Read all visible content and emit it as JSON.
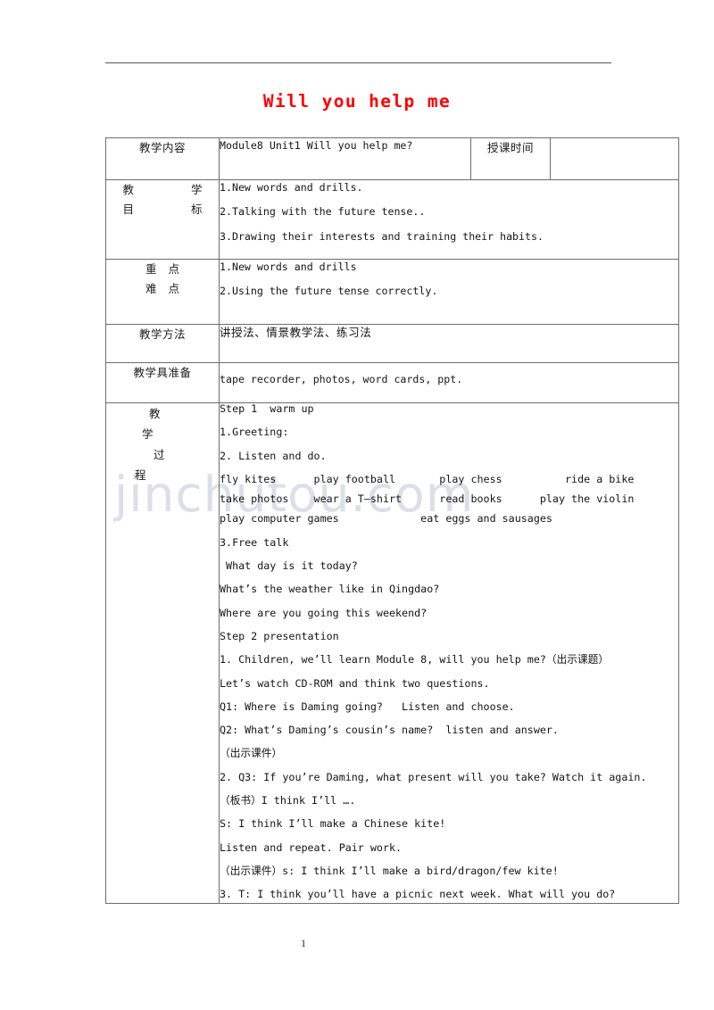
{
  "document": {
    "title": "Will you help me",
    "title_color": "#ff0000",
    "page_number": "1",
    "watermark": "jinchutou.com"
  },
  "table": {
    "rows": {
      "content": {
        "label": "教学内容",
        "value": "Module8 Unit1 Will you help me?",
        "time_label": "授课时间",
        "time_value": ""
      },
      "objectives": {
        "label_line1": "教　　学",
        "label_line2": "目　　标",
        "label_char1": "教",
        "label_char2": "学",
        "label_char3": "目",
        "label_char4": "标",
        "items": [
          "1.New words and drills.",
          "2.Talking with the future tense..",
          "3.Drawing their interests and training their habits."
        ]
      },
      "key_points": {
        "label_char1": "重",
        "label_char2": "点",
        "label_char3": "难",
        "label_char4": "点",
        "items": [
          "1.New words and drills",
          "2.Using the future tense correctly."
        ]
      },
      "methods": {
        "label": "教学方法",
        "value": "讲授法、情景教学法、练习法"
      },
      "materials": {
        "label": "教学具准备",
        "value": "tape recorder, photos, word cards, ppt."
      },
      "process": {
        "label_char1": "教",
        "label_char2": "学",
        "label_char3": "过",
        "label_char4": "程",
        "lines": [
          "Step 1  warm up",
          "1.Greeting:",
          "2. Listen and do.",
          "fly kites      play football       play chess          ride a bike",
          "take photos    wear a T—shirt      read books      play the violin",
          "play computer games             eat eggs and sausages",
          "3.Free talk",
          " What day is it today?",
          "What’s the weather like in Qingdao?",
          "Where are you going this weekend?",
          "Step 2 presentation",
          "1. Children, we’ll learn Module 8, will you help me?（出示课题）",
          "Let’s watch CD-ROM and think two questions.",
          "Q1: Where is Daming going?   Listen and choose.",
          "Q2: What’s Daming’s cousin’s name?  listen and answer.",
          "（出示课件）",
          "2. Q3: If you’re Daming, what present will you take? Watch it again.",
          "（板书）I think I’ll ….",
          "S: I think I’ll make a Chinese kite!",
          "Listen and repeat. Pair work.",
          "（出示课件）s: I think I’ll make a bird/dragon/few kite!",
          "3. T: I think you’ll have a picnic next week. What will you do?"
        ]
      }
    }
  }
}
